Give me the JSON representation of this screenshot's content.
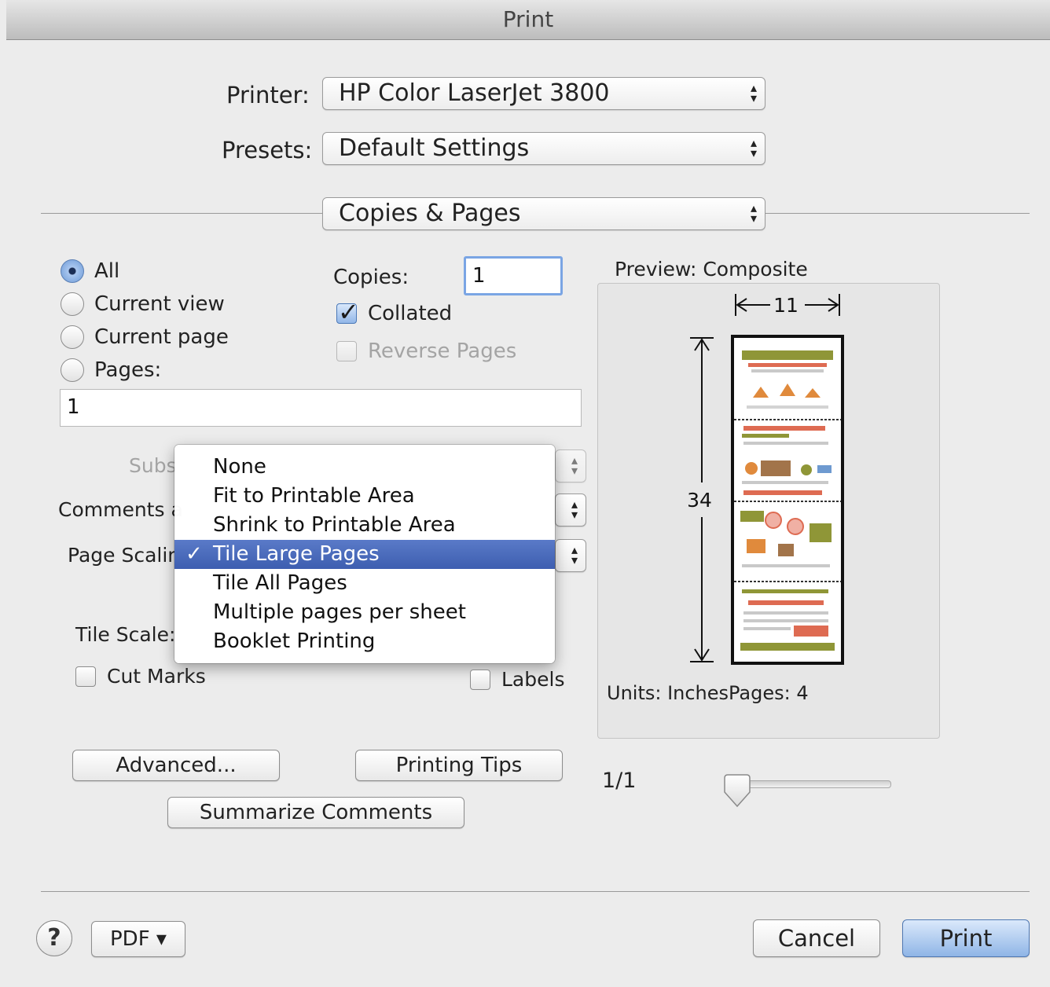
{
  "window": {
    "title": "Print"
  },
  "printer": {
    "label": "Printer:",
    "value": "HP Color LaserJet 3800"
  },
  "presets": {
    "label": "Presets:",
    "value": "Default Settings"
  },
  "section": {
    "value": "Copies & Pages"
  },
  "range": {
    "options": [
      "All",
      "Current view",
      "Current page",
      "Pages:"
    ],
    "selected": "All",
    "pages_value": "1"
  },
  "copies": {
    "label": "Copies:",
    "value": "1",
    "collated_label": "Collated",
    "collated": true,
    "reverse_label": "Reverse Pages",
    "reverse": false
  },
  "subset": {
    "label": "Subs",
    "value": ""
  },
  "comments": {
    "label": "Comments a",
    "value": ""
  },
  "scaling": {
    "label": "Page Scalin",
    "options": [
      "None",
      "Fit to Printable Area",
      "Shrink to Printable Area",
      "Tile Large Pages",
      "Tile All Pages",
      "Multiple pages per sheet",
      "Booklet Printing"
    ],
    "selected": "Tile Large Pages",
    "check_glyph": "✓"
  },
  "tile": {
    "scale_label": "Tile Scale:",
    "cut_marks_label": "Cut Marks",
    "labels_label": "Labels"
  },
  "buttons": {
    "advanced": "Advanced...",
    "printing_tips": "Printing Tips",
    "summarize": "Summarize Comments",
    "help": "?",
    "pdf": "PDF ▾",
    "cancel": "Cancel",
    "print": "Print"
  },
  "preview": {
    "title": "Preview: Composite",
    "width_label": "11",
    "height_label": "34",
    "units_label": "Units: InchesPages: 4",
    "page_indicator": "1/1",
    "tile_count": 4
  },
  "colors": {
    "accent": "#3d5eb0",
    "olive": "#8f9637",
    "orange": "#e08a3c",
    "salmon": "#de6b52"
  }
}
